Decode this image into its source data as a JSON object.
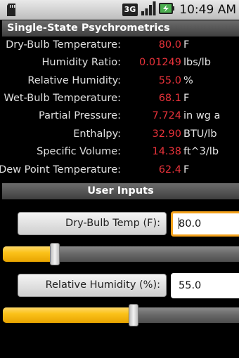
{
  "status_bar": {
    "time": "10:49 AM",
    "network_badge": "3G"
  },
  "header": {
    "title": "Single-State Psychrometrics"
  },
  "results": [
    {
      "label": "Dry-Bulb Temperature:",
      "value": "80.0",
      "unit": "F"
    },
    {
      "label": "Humidity Ratio:",
      "value": "0.01249",
      "unit": "lbs/lb"
    },
    {
      "label": "Relative Humidity:",
      "value": "55.0",
      "unit": "%"
    },
    {
      "label": "Wet-Bulb Temperature:",
      "value": "68.1",
      "unit": "F"
    },
    {
      "label": "Partial Pressure:",
      "value": "7.724",
      "unit": "in wg a"
    },
    {
      "label": "Enthalpy:",
      "value": "32.90",
      "unit": "BTU/lb"
    },
    {
      "label": "Specific Volume:",
      "value": "14.38",
      "unit": "ft^3/lb"
    },
    {
      "label": "Dew Point Temperature:",
      "value": "62.4",
      "unit": "F"
    }
  ],
  "inputs_header": {
    "title": "User Inputs"
  },
  "inputs": [
    {
      "button_label": "Dry-Bulb Temp (F):",
      "value": "80.0",
      "slider_fraction": 0.22,
      "focused": true
    },
    {
      "button_label": "Relative Humidity (%):",
      "value": "55.0",
      "slider_fraction": 0.555,
      "focused": false
    }
  ],
  "colors": {
    "accent": "#fbc21a",
    "value_red": "#e8323a",
    "focus_orange": "#f4a21b"
  }
}
